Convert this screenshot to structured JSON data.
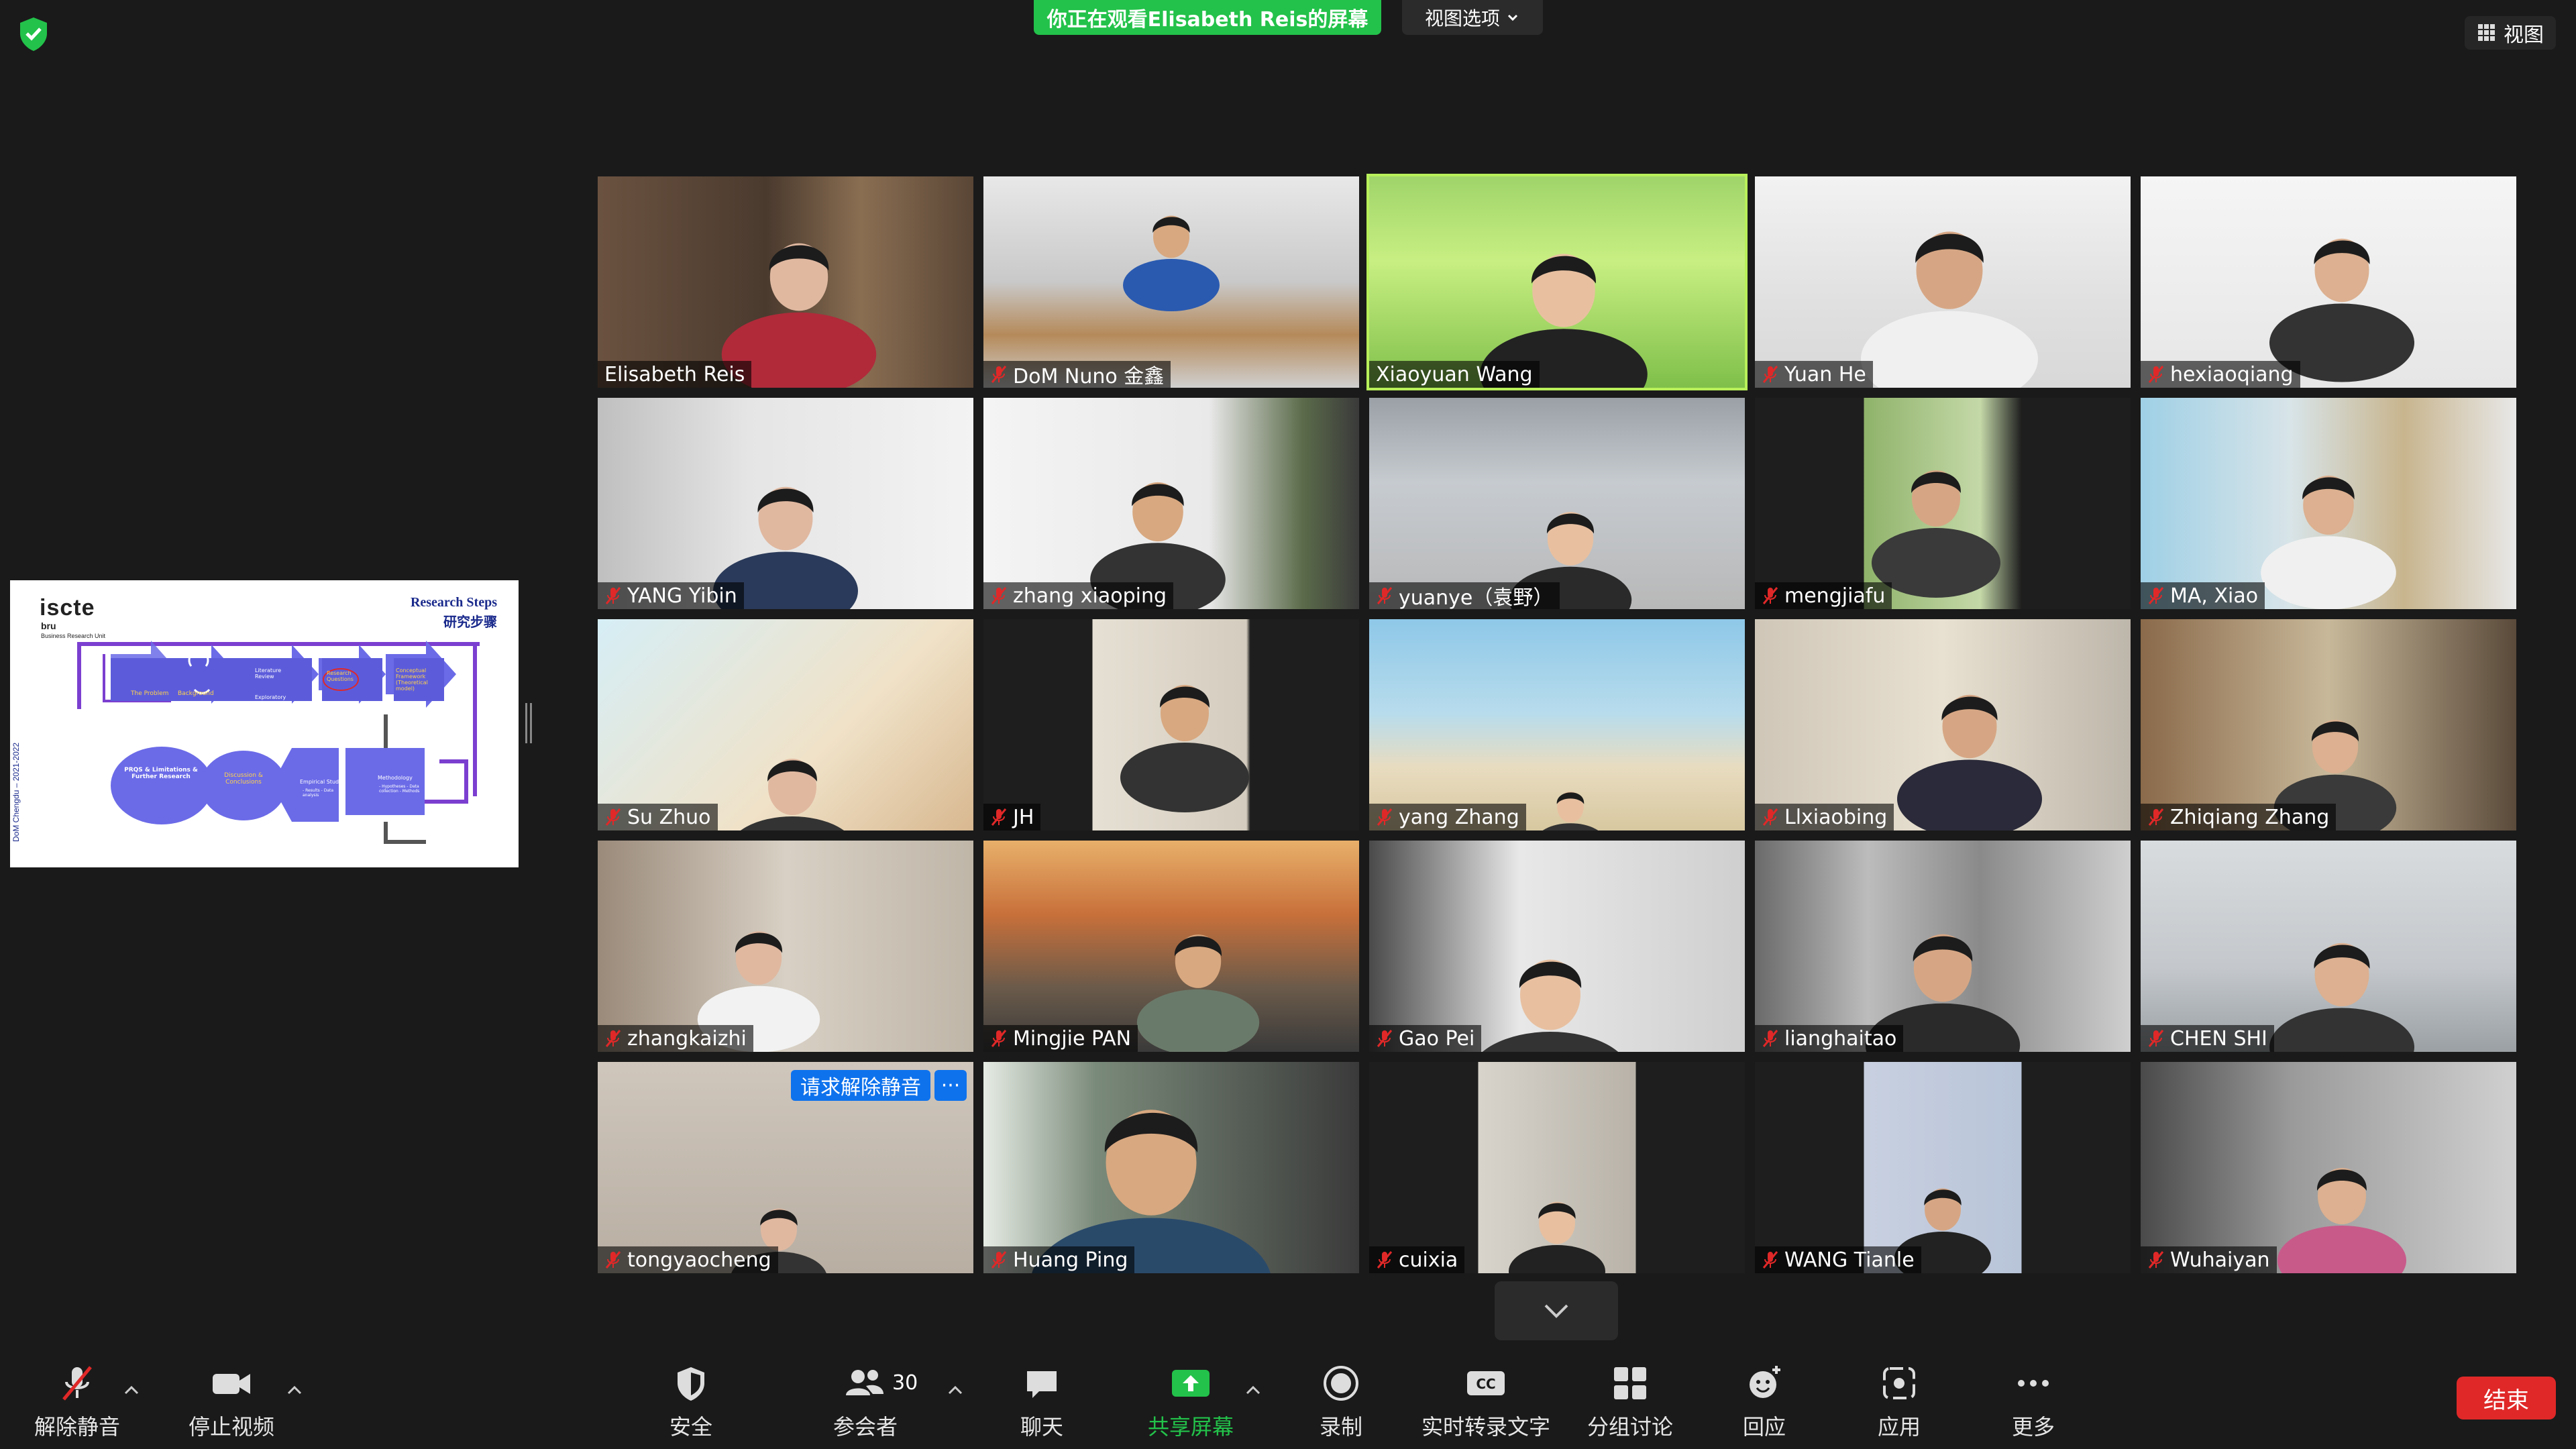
{
  "top": {
    "share_banner": "你正在观看Elisabeth  Reis的屏幕",
    "view_options": "视图选项",
    "view_button": "视图"
  },
  "slide": {
    "logo": "iscte",
    "logo_sub": "bru",
    "logo_sub_small": "Business Research Unit",
    "title_en": "Research Steps",
    "title_zh": "研究步骤",
    "vertical_text": "DoM Chengdu – 2021-2022",
    "boxes": {
      "problem": "The Problem",
      "background": "Background",
      "lit_review": "Literature Review",
      "exploratory": "Exploratory Interviews",
      "research_q": "Research Questions",
      "conceptual": "Conceptual Framework (Theoretical model)",
      "prqs": "PRQS & Limitations & Further Research",
      "discussion": "Discussion & Conclusions",
      "empirical": "Empirical Study",
      "empirical_items": "- Results - Data analysis",
      "methodology": "Methodology",
      "methodology_items": "- Hypotheses - Data collection - Methods"
    }
  },
  "participants": [
    {
      "name": "Elisabeth Reis",
      "muted": false,
      "active": false
    },
    {
      "name": "DoM Nuno 金鑫",
      "muted": true,
      "active": false
    },
    {
      "name": "Xiaoyuan Wang",
      "muted": false,
      "active": true
    },
    {
      "name": "Yuan He",
      "muted": true,
      "active": false
    },
    {
      "name": "hexiaoqiang",
      "muted": true,
      "active": false
    },
    {
      "name": "YANG Yibin",
      "muted": true,
      "active": false
    },
    {
      "name": "zhang xiaoping",
      "muted": true,
      "active": false
    },
    {
      "name": "yuanye（袁野）",
      "muted": true,
      "active": false
    },
    {
      "name": "mengjiafu",
      "muted": true,
      "active": false
    },
    {
      "name": "MA, Xiao",
      "muted": true,
      "active": false
    },
    {
      "name": "Su Zhuo",
      "muted": true,
      "active": false
    },
    {
      "name": "JH",
      "muted": true,
      "active": false
    },
    {
      "name": "yang Zhang",
      "muted": true,
      "active": false
    },
    {
      "name": "Llxiaobing",
      "muted": true,
      "active": false
    },
    {
      "name": "Zhiqiang Zhang",
      "muted": true,
      "active": false
    },
    {
      "name": "zhangkaizhi",
      "muted": true,
      "active": false
    },
    {
      "name": "Mingjie PAN",
      "muted": true,
      "active": false
    },
    {
      "name": "Gao Pei",
      "muted": true,
      "active": false
    },
    {
      "name": "lianghaitao",
      "muted": true,
      "active": false
    },
    {
      "name": "CHEN SHI",
      "muted": true,
      "active": false
    },
    {
      "name": "tongyaocheng",
      "muted": true,
      "active": false
    },
    {
      "name": "Huang Ping",
      "muted": true,
      "active": false
    },
    {
      "name": "cuixia",
      "muted": true,
      "active": false
    },
    {
      "name": "WANG  Tianle",
      "muted": true,
      "active": false
    },
    {
      "name": "Wuhaiyan",
      "muted": true,
      "active": false
    }
  ],
  "tile_actions": {
    "request_unmute": "请求解除静音",
    "more": "···"
  },
  "toolbar": {
    "unmute": "解除静音",
    "stop_video": "停止视频",
    "security": "安全",
    "participants": "参会者",
    "participants_count": "30",
    "chat": "聊天",
    "share_screen": "共享屏幕",
    "record": "录制",
    "live_transcript": "实时转录文字",
    "live_transcript_icon": "CC",
    "breakout": "分组讨论",
    "reactions": "回应",
    "apps": "应用",
    "more": "更多",
    "end": "结束"
  },
  "colors": {
    "share_green": "#23c24a",
    "active_speaker": "#b8f05a",
    "mute_red": "#e02828",
    "end_red": "#e02828",
    "request_blue": "#0e72ed"
  }
}
